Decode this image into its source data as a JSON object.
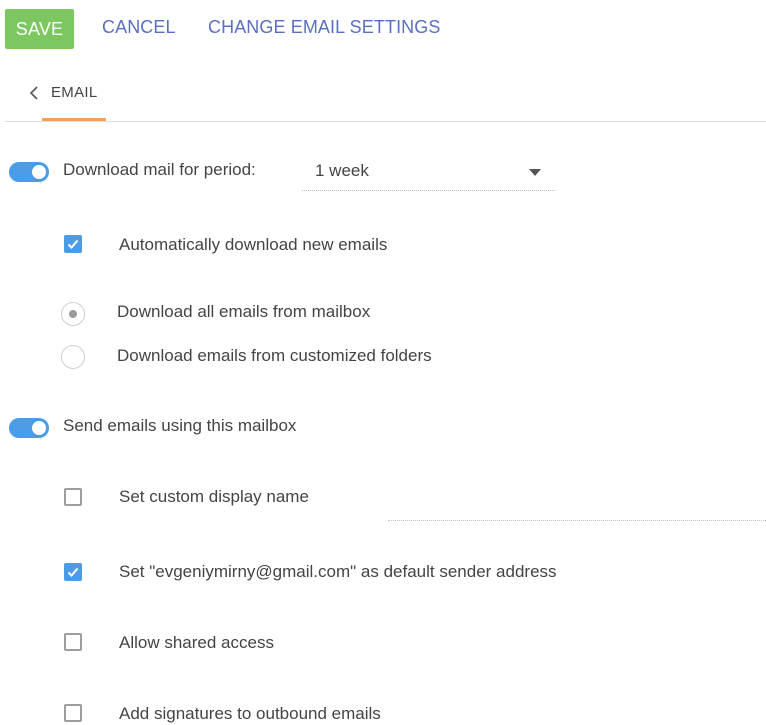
{
  "toolbar": {
    "save_label": "SAVE",
    "cancel_label": "CANCEL",
    "change_email_settings_label": "CHANGE EMAIL SETTINGS"
  },
  "tab": {
    "label": "EMAIL",
    "icon": "chevron-left-icon"
  },
  "download": {
    "toggle_on": true,
    "label": "Download mail for period:",
    "period_value": "1 week",
    "auto_download": {
      "label": "Automatically download new emails",
      "checked": true
    },
    "mode_options": [
      {
        "label": "Download all emails from mailbox",
        "selected": true
      },
      {
        "label": "Download emails from customized folders",
        "selected": false
      }
    ]
  },
  "send": {
    "toggle_on": true,
    "label": "Send emails using this mailbox",
    "options": [
      {
        "label": "Set custom display name",
        "checked": false
      },
      {
        "label": "Set \"evgeniymirny@gmail.com\" as default sender address",
        "checked": true
      },
      {
        "label": "Allow shared access",
        "checked": false
      },
      {
        "label": "Add signatures to outbound emails",
        "checked": false
      }
    ],
    "display_name_value": ""
  },
  "colors": {
    "save_button": "#7dc760",
    "link": "#5a6fc4",
    "accent_blue": "#4a9ce8",
    "tab_underline": "#f0a358"
  }
}
